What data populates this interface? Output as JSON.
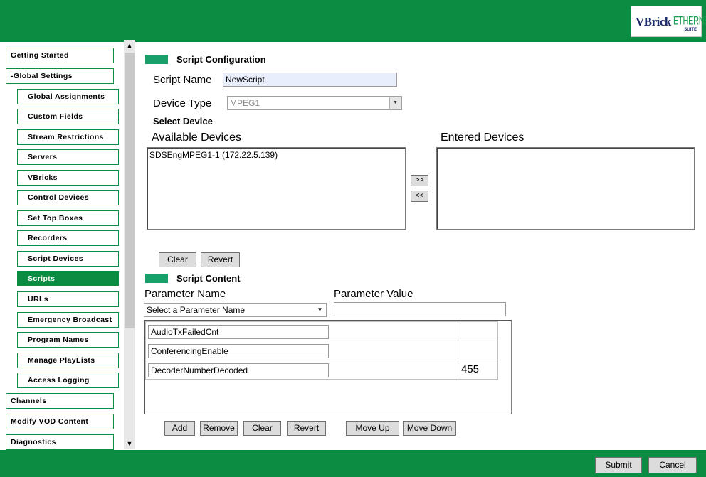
{
  "brand": {
    "logo_main": "VBrick",
    "logo_sub": "ETHERNETV",
    "logo_suite": "SUITE",
    "primary_color": "#0b8c43",
    "accent_color": "#19a06a"
  },
  "sidebar": {
    "items": [
      {
        "label": "Getting Started",
        "level": "top",
        "active": false
      },
      {
        "label": "-Global Settings",
        "level": "top",
        "active": false
      },
      {
        "label": "Global Assignments",
        "level": "sub",
        "active": false
      },
      {
        "label": "Custom Fields",
        "level": "sub",
        "active": false
      },
      {
        "label": "Stream Restrictions",
        "level": "sub",
        "active": false
      },
      {
        "label": "Servers",
        "level": "sub",
        "active": false
      },
      {
        "label": "VBricks",
        "level": "sub",
        "active": false
      },
      {
        "label": "Control Devices",
        "level": "sub",
        "active": false
      },
      {
        "label": "Set Top Boxes",
        "level": "sub",
        "active": false
      },
      {
        "label": "Recorders",
        "level": "sub",
        "active": false
      },
      {
        "label": "Script Devices",
        "level": "sub",
        "active": false
      },
      {
        "label": "Scripts",
        "level": "sub",
        "active": true
      },
      {
        "label": "URLs",
        "level": "sub",
        "active": false
      },
      {
        "label": "Emergency Broadcast",
        "level": "sub",
        "active": false
      },
      {
        "label": "Program Names",
        "level": "sub",
        "active": false
      },
      {
        "label": "Manage PlayLists",
        "level": "sub",
        "active": false
      },
      {
        "label": "Access Logging",
        "level": "sub",
        "active": false
      },
      {
        "label": "Channels",
        "level": "top",
        "active": false
      },
      {
        "label": "Modify VOD Content",
        "level": "top",
        "active": false
      },
      {
        "label": "Diagnostics",
        "level": "top",
        "active": false
      }
    ],
    "scroll_up_icon": "triangle-up-icon",
    "scroll_down_icon": "triangle-down-icon"
  },
  "script_config": {
    "title": "Script Configuration",
    "script_name_label": "Script Name",
    "script_name_value": "NewScript",
    "device_type_label": "Device Type",
    "device_type_value": "MPEG1",
    "select_device_label": "Select Device",
    "available_label": "Available Devices",
    "entered_label": "Entered Devices",
    "available_devices": [
      "SDSEngMPEG1-1 (172.22.5.139)"
    ],
    "entered_devices": [],
    "add_label": ">>",
    "remove_label": "<<",
    "clear_label": "Clear",
    "revert_label": "Revert"
  },
  "script_content": {
    "title": "Script Content",
    "param_name_label": "Parameter Name",
    "param_value_label": "Parameter Value",
    "param_select_value": "Select a Parameter Name",
    "param_value_input": "",
    "rows": [
      {
        "name": "AudioTxFailedCnt",
        "value": ""
      },
      {
        "name": "ConferencingEnable",
        "value": ""
      },
      {
        "name": "DecoderNumberDecoded",
        "value": "455"
      }
    ],
    "buttons": {
      "add": "Add",
      "remove": "Remove",
      "clear": "Clear",
      "revert": "Revert",
      "move_up": "Move Up",
      "move_down": "Move Down"
    }
  },
  "footer": {
    "submit_label": "Submit",
    "cancel_label": "Cancel"
  }
}
